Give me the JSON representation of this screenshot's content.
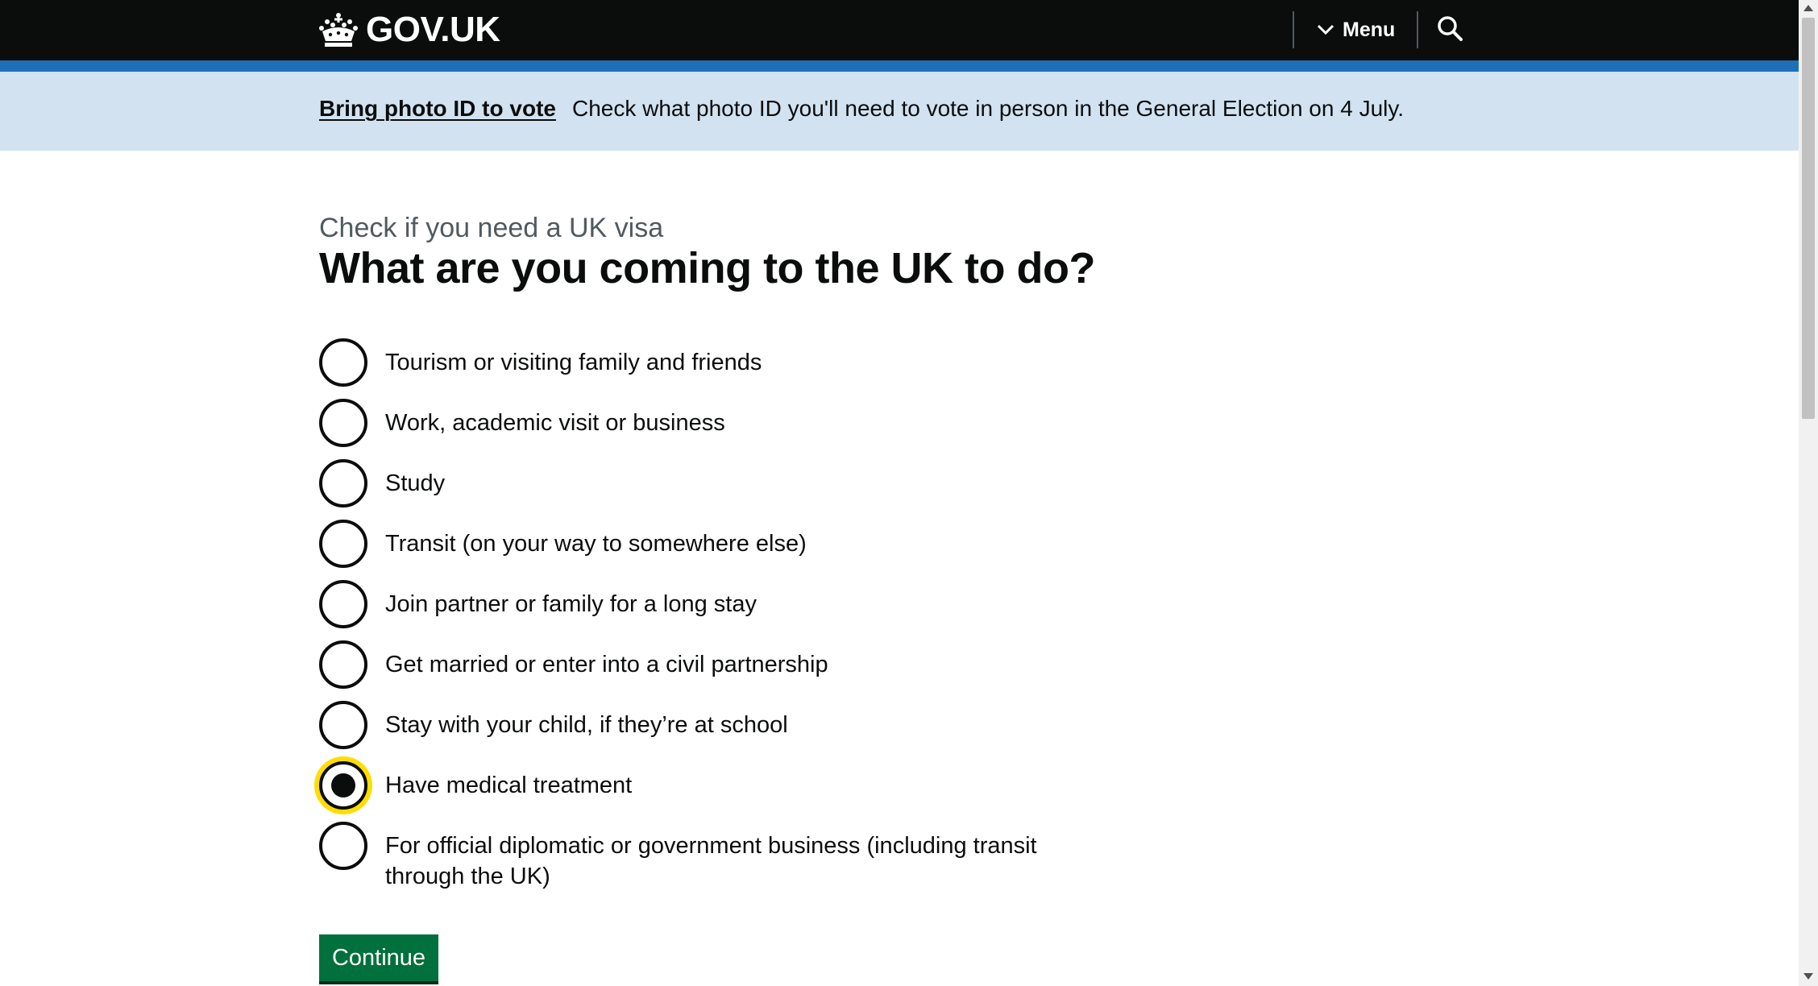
{
  "header": {
    "logo_text": "GOV.UK",
    "menu_label": "Menu"
  },
  "banner": {
    "link_text": "Bring photo ID to vote",
    "text": "Check what photo ID you'll need to vote in person in the General Election on 4 July."
  },
  "main": {
    "caption": "Check if you need a UK visa",
    "heading": "What are you coming to the UK to do?",
    "options": [
      {
        "label": "Tourism or visiting family and friends",
        "checked": false
      },
      {
        "label": "Work, academic visit or business",
        "checked": false
      },
      {
        "label": "Study",
        "checked": false
      },
      {
        "label": "Transit (on your way to somewhere else)",
        "checked": false
      },
      {
        "label": "Join partner or family for a long stay",
        "checked": false
      },
      {
        "label": "Get married or enter into a civil partnership",
        "checked": false
      },
      {
        "label": "Stay with your child, if they’re at school",
        "checked": false
      },
      {
        "label": "Have medical treatment",
        "checked": true
      },
      {
        "label": "For official diplomatic or government business (including transit through the UK)",
        "checked": false
      }
    ],
    "continue_label": "Continue"
  },
  "colors": {
    "header_bg": "#0b0c0c",
    "header_stripe": "#1d70b8",
    "banner_bg": "#d2e2f1",
    "button_green": "#00703c",
    "focus_yellow": "#ffdd00"
  },
  "icons": {
    "logo": "crown-icon",
    "menu": "chevron-down-icon",
    "search": "search-icon"
  }
}
